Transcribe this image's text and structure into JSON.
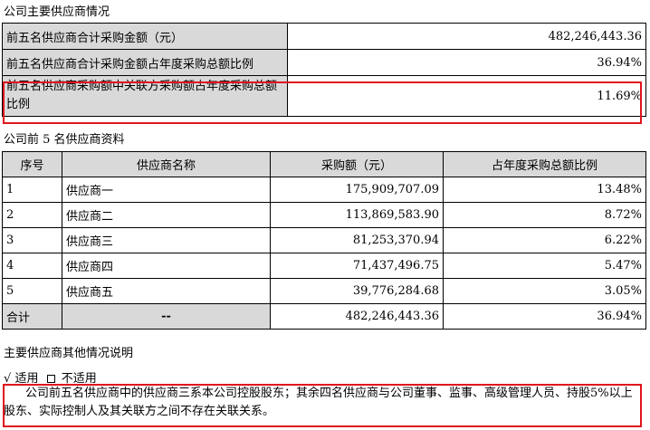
{
  "section1": {
    "title": "公司主要供应商情况",
    "rows": [
      {
        "label": "前五名供应商合计采购金额（元）",
        "value": "482,246,443.36"
      },
      {
        "label": "前五名供应商合计采购金额占年度采购总额比例",
        "value": "36.94%"
      },
      {
        "label": "前五名供应商采购额中关联方采购额占年度采购总额比例",
        "value": "11.69%"
      }
    ]
  },
  "section2": {
    "title": "公司前 5 名供应商资料",
    "headers": [
      "序号",
      "供应商名称",
      "采购额（元）",
      "占年度采购总额比例"
    ],
    "rows": [
      [
        "1",
        "供应商一",
        "175,909,707.09",
        "13.48%"
      ],
      [
        "2",
        "供应商二",
        "113,869,583.90",
        "8.72%"
      ],
      [
        "3",
        "供应商三",
        "81,253,370.94",
        "6.22%"
      ],
      [
        "4",
        "供应商四",
        "71,437,496.75",
        "5.47%"
      ],
      [
        "5",
        "供应商五",
        "39,776,284.68",
        "3.05%"
      ]
    ],
    "total": [
      "合计",
      "--",
      "482,246,443.36",
      "36.94%"
    ]
  },
  "section3": {
    "title": "主要供应商其他情况说明",
    "check_mark": "√",
    "applicable": "适用",
    "not_applicable": "不适用",
    "paragraph": "公司前五名供应商中的供应商三系本公司控股股东；其余四名供应商与公司董事、监事、高级管理人员、持股5%以上股东、实际控制人及其关联方之间不存在关联关系。"
  }
}
